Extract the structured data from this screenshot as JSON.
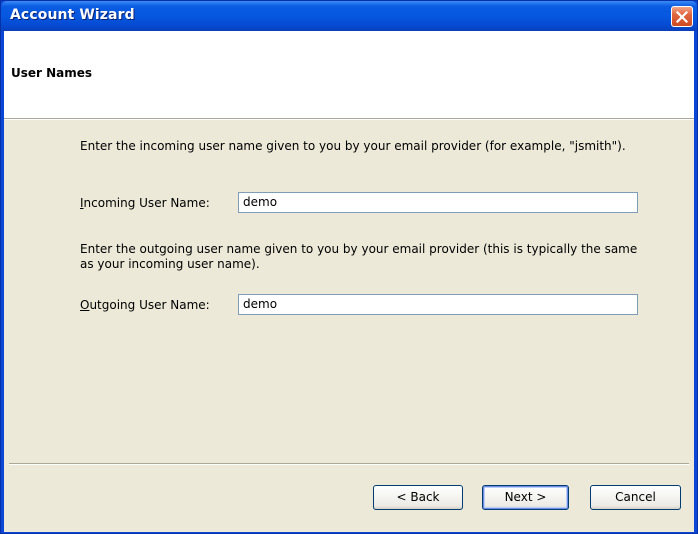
{
  "window": {
    "title": "Account Wizard"
  },
  "page": {
    "title": "User Names"
  },
  "incoming": {
    "description": "Enter the incoming user name given to you by your email provider (for example, \"jsmith\").",
    "label": "Incoming User Name:",
    "value": "demo"
  },
  "outgoing": {
    "description": "Enter the outgoing user name given to you by your email provider (this is typically the same as your incoming user name).",
    "label": "Outgoing User Name:",
    "value": "demo"
  },
  "buttons": {
    "back": "< Back",
    "next": "Next >",
    "cancel": "Cancel"
  },
  "colors": {
    "titlebar": "#0658e0",
    "dialog_bg": "#ece9d8",
    "close_button": "#e0663f"
  },
  "icons": {
    "close": "close-icon"
  }
}
